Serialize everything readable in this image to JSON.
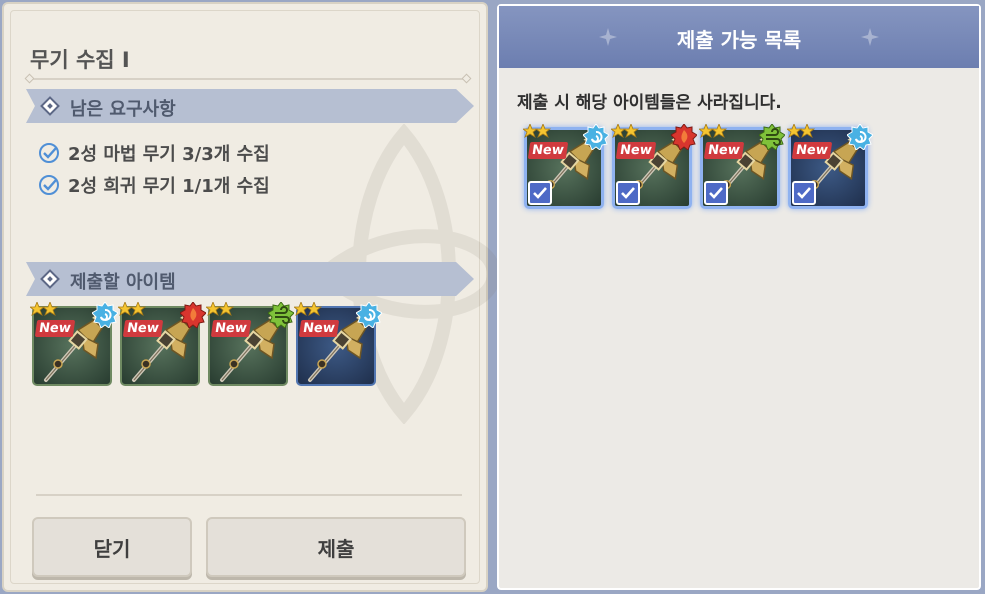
{
  "left_panel": {
    "title": "무기 수집 I",
    "requirements_header": "남은 요구사항",
    "requirements": [
      {
        "text": "2성 마법 무기 3/3개 수집",
        "done": true
      },
      {
        "text": "2성 희귀 무기 1/1개 수집",
        "done": true
      }
    ],
    "items_header": "제출할 아이템",
    "items": [
      {
        "badge": "New",
        "element": "water-icon",
        "frame": "green"
      },
      {
        "badge": "New",
        "element": "fire-icon",
        "frame": "green"
      },
      {
        "badge": "New",
        "element": "wind-icon",
        "frame": "green"
      },
      {
        "badge": "New",
        "element": "water-icon",
        "frame": "blue"
      }
    ],
    "close_label": "닫기",
    "submit_label": "제출"
  },
  "right_panel": {
    "header": "제출 가능 목록",
    "notice": "제출 시 해당 아이템들은 사라집니다.",
    "items": [
      {
        "badge": "New",
        "element": "water-icon",
        "checked": true
      },
      {
        "badge": "New",
        "element": "fire-icon",
        "checked": true
      },
      {
        "badge": "New",
        "element": "wind-icon",
        "checked": true
      },
      {
        "badge": "New",
        "element": "water-icon",
        "checked": true
      }
    ]
  },
  "colors": {
    "header_blue": "#7386b8",
    "section_bar": "#b6bfd2",
    "new_badge": "#d03a3e",
    "check_blue": "#4e6ac6"
  }
}
